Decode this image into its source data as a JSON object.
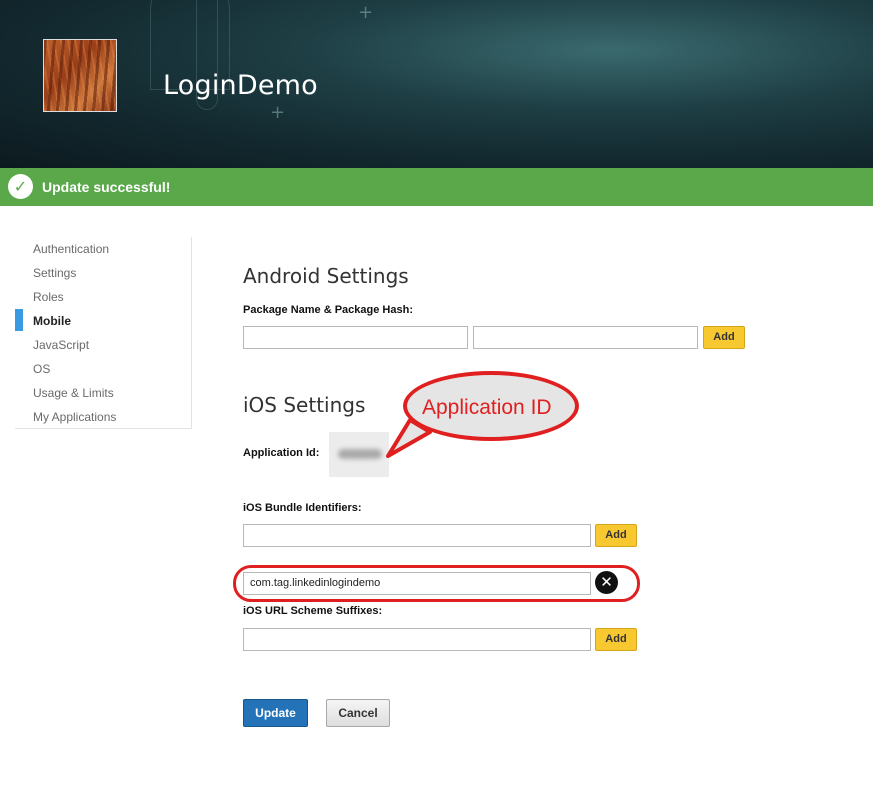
{
  "header": {
    "app_title": "LoginDemo"
  },
  "banner": {
    "message": "Update successful!"
  },
  "sidebar": {
    "items": [
      {
        "label": "Authentication",
        "active": false
      },
      {
        "label": "Settings",
        "active": false
      },
      {
        "label": "Roles",
        "active": false
      },
      {
        "label": "Mobile",
        "active": true
      },
      {
        "label": "JavaScript",
        "active": false
      },
      {
        "label": "OS",
        "active": false
      },
      {
        "label": "Usage & Limits",
        "active": false
      },
      {
        "label": "My Applications",
        "active": false
      }
    ]
  },
  "android": {
    "title": "Android Settings",
    "package_label": "Package Name & Package Hash:",
    "package_name_value": "",
    "package_hash_value": "",
    "add_label": "Add"
  },
  "ios": {
    "title": "iOS Settings",
    "app_id_label": "Application Id:",
    "bundle_label": "iOS Bundle Identifiers:",
    "bundle_input_value": "",
    "bundle_add_label": "Add",
    "bundle_entry": "com.tag.linkedinlogindemo",
    "url_scheme_label": "iOS URL Scheme Suffixes:",
    "url_scheme_value": "",
    "url_add_label": "Add"
  },
  "annotation": {
    "callout_text": "Application ID",
    "color": "#e02020"
  },
  "actions": {
    "update_label": "Update",
    "cancel_label": "Cancel"
  },
  "colors": {
    "success": "#5aa84a",
    "primary": "#2473b8",
    "add_button": "#f7c830",
    "active_marker": "#3a9be0"
  },
  "icons": [
    "check-icon",
    "remove-icon"
  ]
}
